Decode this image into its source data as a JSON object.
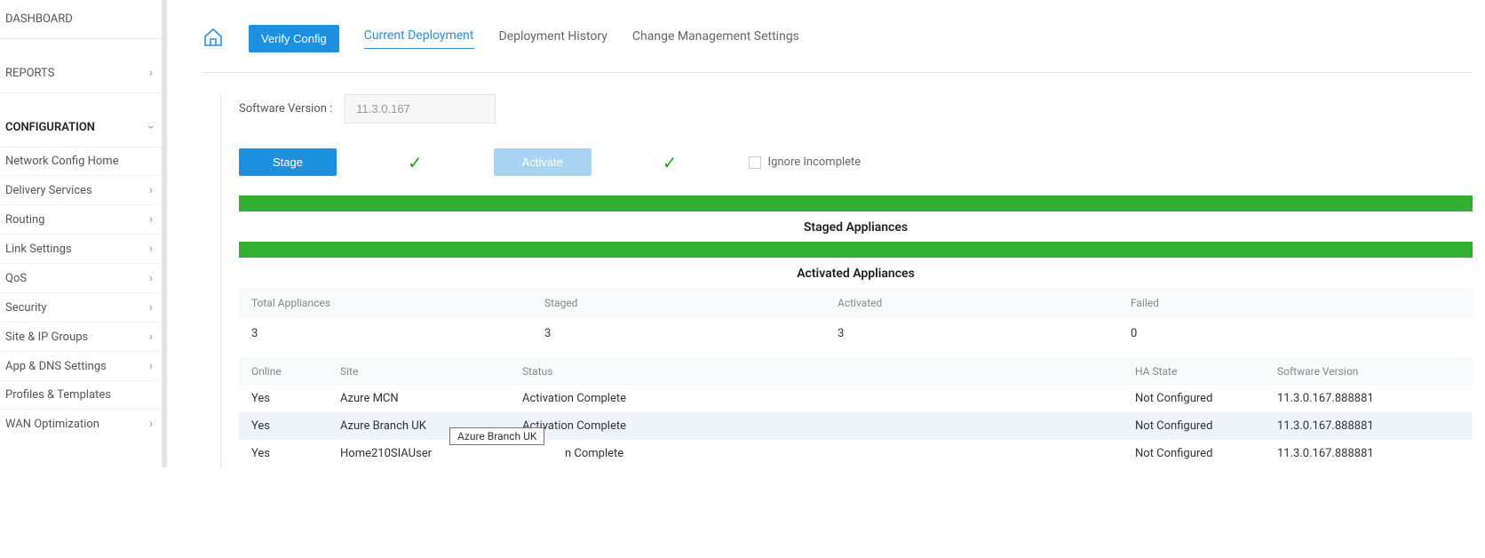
{
  "sidebar": {
    "dashboard": "DASHBOARD",
    "reports": "REPORTS",
    "configuration": "CONFIGURATION",
    "items": [
      {
        "label": "Network Config Home",
        "expand": false
      },
      {
        "label": "Delivery Services",
        "expand": true
      },
      {
        "label": "Routing",
        "expand": true
      },
      {
        "label": "Link Settings",
        "expand": true
      },
      {
        "label": "QoS",
        "expand": true
      },
      {
        "label": "Security",
        "expand": true
      },
      {
        "label": "Site & IP Groups",
        "expand": true
      },
      {
        "label": "App & DNS Settings",
        "expand": true
      },
      {
        "label": "Profiles & Templates",
        "expand": false
      },
      {
        "label": "WAN Optimization",
        "expand": true
      }
    ]
  },
  "tabs": {
    "verify": "Verify Config",
    "current": "Current Deployment",
    "history": "Deployment History",
    "change": "Change Management Settings"
  },
  "software": {
    "label": "Software Version :",
    "value": "11.3.0.167"
  },
  "actions": {
    "stage": "Stage",
    "activate": "Activate",
    "ignore": "Ignore Incomplete"
  },
  "sections": {
    "staged": "Staged Appliances",
    "activated": "Activated Appliances"
  },
  "summary": {
    "headers": [
      "Total Appliances",
      "Staged",
      "Activated",
      "Failed"
    ],
    "values": [
      "3",
      "3",
      "3",
      "0"
    ]
  },
  "table": {
    "headers": [
      "Online",
      "Site",
      "Status",
      "HA State",
      "Software Version"
    ],
    "rows": [
      {
        "online": "Yes",
        "site": "Azure MCN",
        "status": "Activation Complete",
        "ha": "Not Configured",
        "sv": "11.3.0.167.888881"
      },
      {
        "online": "Yes",
        "site": "Azure Branch UK",
        "status": "Activation Complete",
        "ha": "Not Configured",
        "sv": "11.3.0.167.888881"
      },
      {
        "online": "Yes",
        "site": "Home210SIAUser",
        "status": "n Complete",
        "ha": "Not Configured",
        "sv": "11.3.0.167.888881"
      }
    ]
  },
  "tooltip": "Azure Branch UK"
}
